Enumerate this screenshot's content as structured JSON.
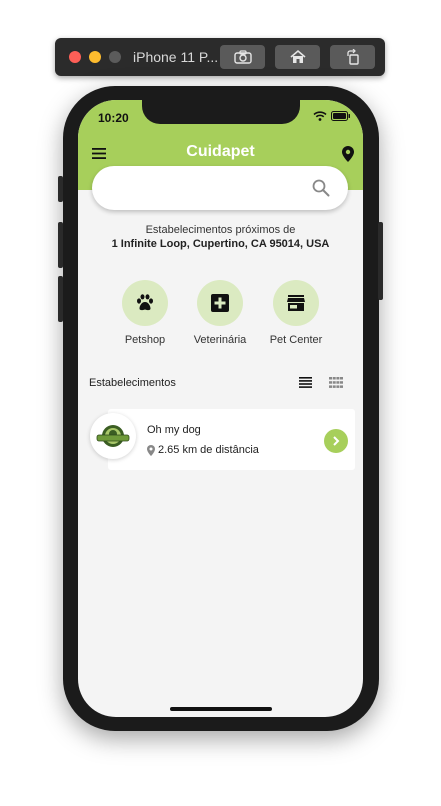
{
  "simulator": {
    "title": "iPhone 11 P..."
  },
  "status_bar": {
    "time": "10:20"
  },
  "header": {
    "title": "Cuidapet",
    "menu_icon": "menu-icon",
    "location_icon": "location-pin-icon",
    "accent_color": "#a7cf5b"
  },
  "search": {
    "value": "",
    "placeholder": ""
  },
  "nearby": {
    "label": "Estabelecimentos próximos de",
    "address": "1 Infinite Loop, Cupertino, CA 95014, USA"
  },
  "categories": [
    {
      "label": "Petshop",
      "icon": "paw-icon"
    },
    {
      "label": "Veterinária",
      "icon": "medical-cross-icon"
    },
    {
      "label": "Pet Center",
      "icon": "store-icon"
    }
  ],
  "establishments": {
    "title": "Estabelecimentos",
    "items": [
      {
        "name": "Oh my dog",
        "distance": "2.65 km de distância"
      }
    ]
  }
}
